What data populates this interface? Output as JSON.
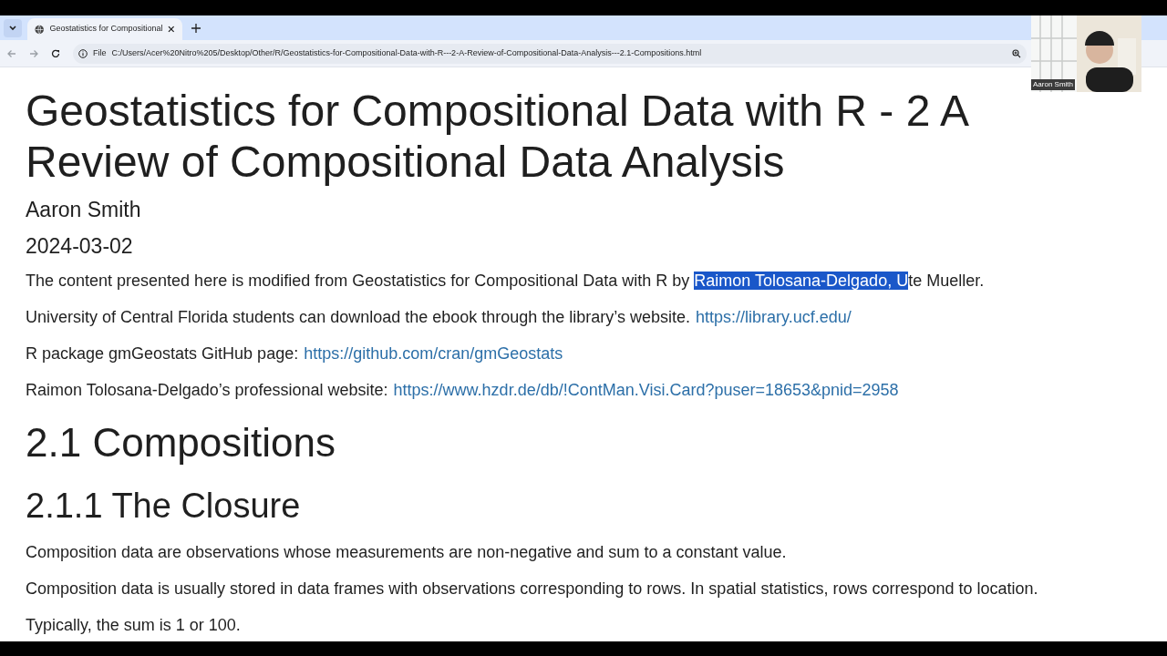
{
  "browser": {
    "tab": {
      "title": "Geostatistics for Compositional",
      "selected": true
    },
    "address": {
      "scheme": "File",
      "url": "C:/Users/Acer%20Nitro%205/Desktop/Other/R/Geostatistics-for-Compositional-Data-with-R---2-A-Review-of-Compositional-Data-Analysis---2.1-Compositions.html"
    }
  },
  "webcam": {
    "name": "Aaron Smith"
  },
  "document": {
    "title": "Geostatistics for Compositional Data with R - 2 A Review of Compositional Data Analysis",
    "author": "Aaron Smith",
    "date": "2024-03-02",
    "blocks": [
      {
        "kind": "selection",
        "before": "The content presented here is modified from Geostatistics for Compositional Data with R by ",
        "selected": "Raimon Tolosana-Delgado, U",
        "after": "te Mueller."
      },
      {
        "kind": "link",
        "text": "University of Central Florida students can download the ebook through the library’s website.",
        "link": "https://library.ucf.edu/"
      },
      {
        "kind": "link",
        "text": "R package gmGeostats GitHub page:",
        "link": "https://github.com/cran/gmGeostats"
      },
      {
        "kind": "link",
        "text": "Raimon Tolosana-Delgado’s professional website:",
        "link": "https://www.hzdr.de/db/!ContMan.Visi.Card?puser=18653&pnid=2958"
      },
      {
        "kind": "h2",
        "text": "2.1 Compositions"
      },
      {
        "kind": "h3",
        "text": "2.1.1 The Closure"
      },
      {
        "kind": "p",
        "text": "Composition data are observations whose measurements are non-negative and sum to a constant value."
      },
      {
        "kind": "p",
        "text": "Composition data is usually stored in data frames with observations corresponding to rows. In spatial statistics, rows correspond to location."
      },
      {
        "kind": "p",
        "text": "Typically, the sum is 1 or 100."
      }
    ]
  }
}
